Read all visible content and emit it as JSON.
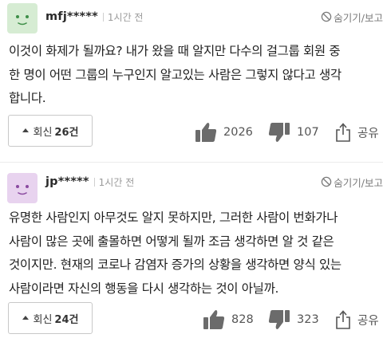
{
  "colors": {
    "avatar1_bg": "#d6ecd3",
    "avatar1_face": "#3e8f48",
    "avatar2_bg": "#e8d3ef",
    "avatar2_face": "#8a4aa0"
  },
  "comments": [
    {
      "avatar_icon": "smiley-face-icon",
      "username": "mfj*****",
      "time": "1시간 전",
      "hide_label": "숨기기/보고",
      "lines": [
        "이것이 화제가 될까요? 내가 왔을 때 알지만 다수의 걸그룹 회원 중",
        "한 명이 어떤 그룹의 누구인지 알고있는 사람은 그렇지 않다고 생각",
        "합니다."
      ],
      "reply_label": "회신",
      "reply_count": "26건",
      "likes": "2026",
      "dislikes": "107",
      "share_label": "공유"
    },
    {
      "avatar_icon": "smiley-face-icon",
      "username": "jp*****",
      "time": "1시간 전",
      "hide_label": "숨기기/보고",
      "lines": [
        "유명한 사람인지 아무것도 알지 못하지만, 그러한 사람이 번화가나",
        "사람이 많은 곳에 출몰하면 어떻게 될까 조금 생각하면 알 것 같은",
        "것이지만. 현재의 코로나 감염자 증가의 상황을 생각하면 양식 있는",
        "사람이라면 자신의 행동을 다시 생각하는 것이 아닐까."
      ],
      "reply_label": "회신",
      "reply_count": "24건",
      "likes": "828",
      "dislikes": "323",
      "share_label": "공유"
    }
  ]
}
